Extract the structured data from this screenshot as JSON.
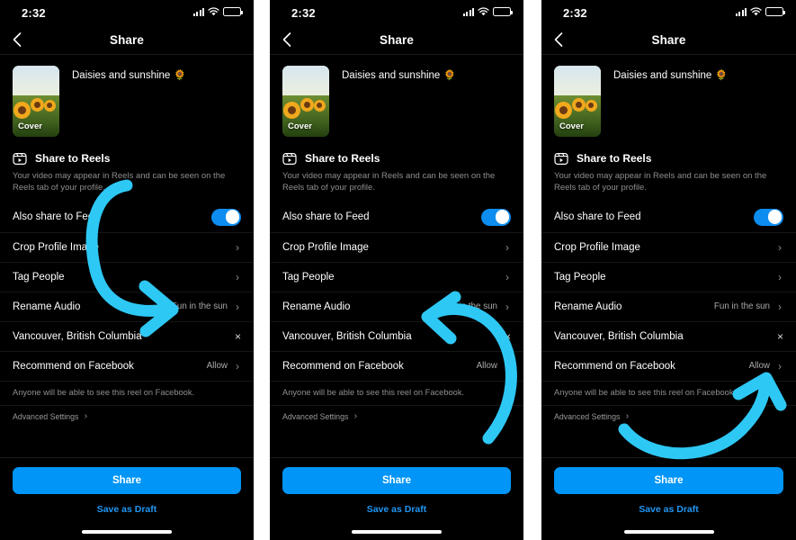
{
  "meta": {
    "accent_blue": "#0095F6",
    "arrow_cyan": "#2ec8f5",
    "background": "#000000",
    "panel_count": 3
  },
  "status": {
    "time": "2:32",
    "signal_icon": "cellular-signal-icon",
    "wifi_icon": "wifi-icon",
    "battery_icon": "battery-icon"
  },
  "nav": {
    "back_icon": "back-chevron-icon",
    "title": "Share"
  },
  "media": {
    "thumbnail_label": "Cover",
    "caption": "Daisies and sunshine",
    "caption_emoji": "🌻"
  },
  "reels": {
    "icon": "reels-icon",
    "title": "Share to Reels",
    "description": "Your video may appear in Reels and can be seen on the Reels tab of your profile."
  },
  "settings": {
    "rows": [
      {
        "label": "Also share to Feed",
        "control": "toggle",
        "toggle_on": true,
        "value": ""
      },
      {
        "label": "Crop Profile Image",
        "control": "chevron",
        "value": ""
      },
      {
        "label": "Tag People",
        "control": "chevron",
        "value": ""
      },
      {
        "label": "Rename Audio",
        "control": "chevron",
        "value": "Fun in the sun"
      },
      {
        "label": "Vancouver, British Columbia",
        "control": "close",
        "value": ""
      },
      {
        "label": "Recommend on Facebook",
        "control": "chevron",
        "value": "Allow"
      }
    ],
    "facebook_hint": "Anyone will be able to see this reel on Facebook.",
    "advanced_label": "Advanced Settings"
  },
  "footer": {
    "share_button": "Share",
    "draft_link": "Save as Draft"
  },
  "annotations": [
    {
      "panel": 1,
      "target": "Rename Audio — Fun in the sun",
      "shape": "curved-arrow-down-right"
    },
    {
      "panel": 2,
      "target": "Vancouver, British Columbia",
      "shape": "curved-arrow-up-left"
    },
    {
      "panel": 3,
      "target": "Recommend on Facebook — Allow",
      "shape": "curved-arrow-up-right"
    }
  ]
}
